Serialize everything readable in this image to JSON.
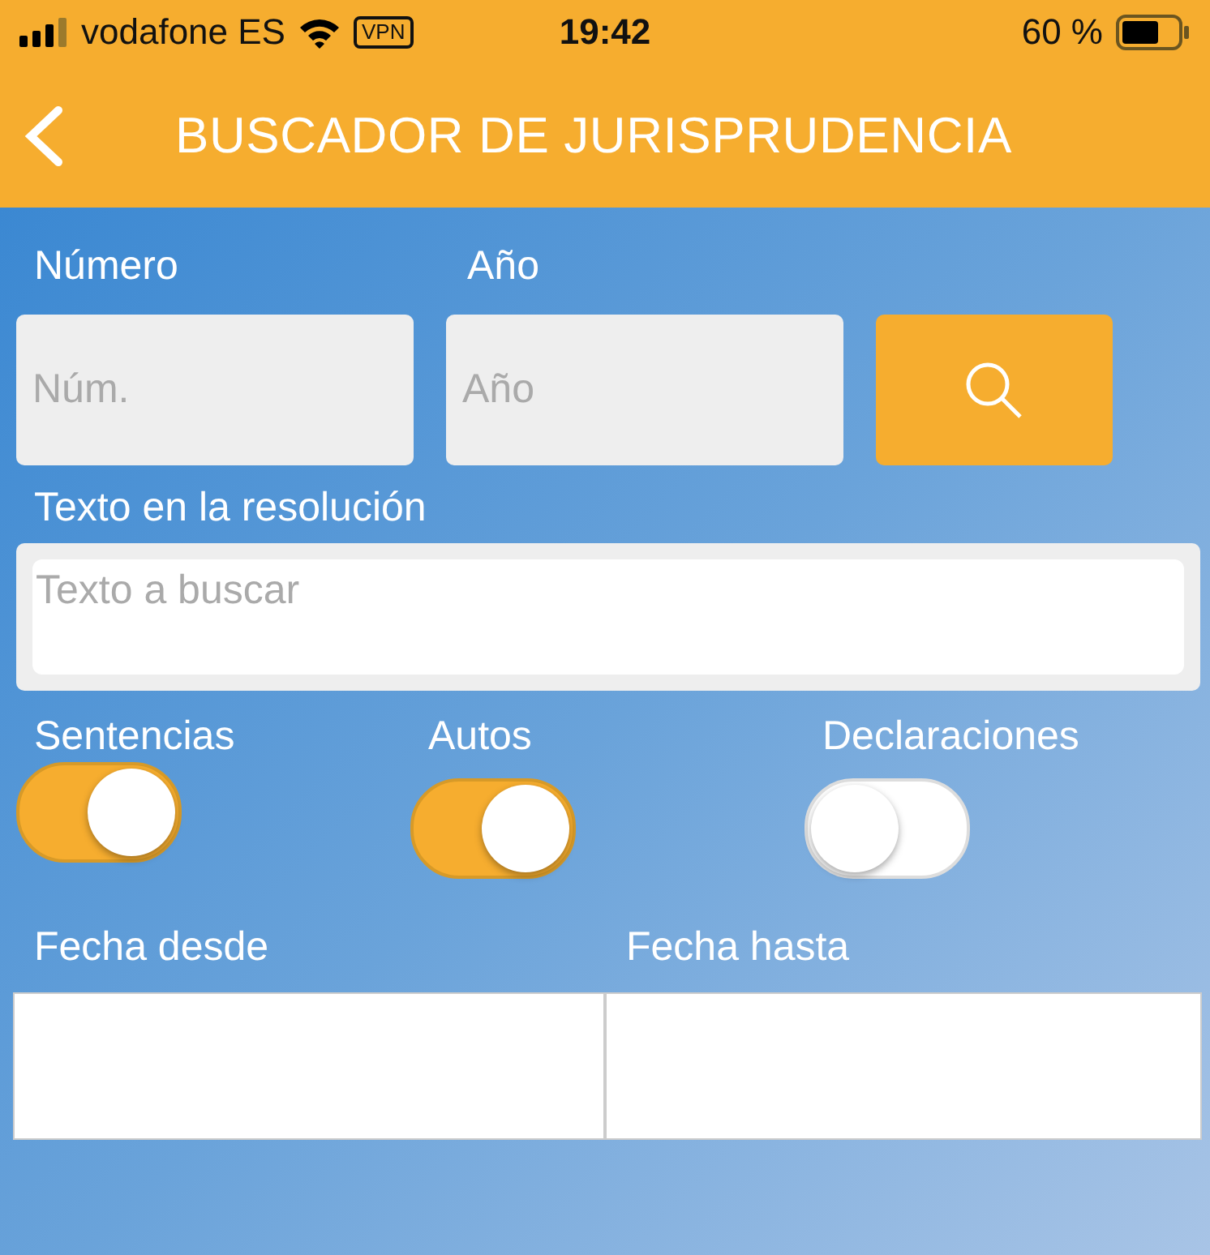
{
  "status_bar": {
    "carrier": "vodafone ES",
    "vpn": "VPN",
    "time": "19:42",
    "battery": "60 %"
  },
  "header": {
    "title": "BUSCADOR DE JURISPRUDENCIA"
  },
  "numero": {
    "label": "Número",
    "placeholder": "Núm."
  },
  "anio": {
    "label": "Año",
    "placeholder": "Año"
  },
  "texto": {
    "label": "Texto en la resolución",
    "placeholder": "Texto a buscar"
  },
  "toggles": [
    {
      "label": "Sentencias",
      "on": true
    },
    {
      "label": "Autos",
      "on": true
    },
    {
      "label": "Declaraciones",
      "on": false
    }
  ],
  "fecha_desde": {
    "label": "Fecha desde"
  },
  "fecha_hasta": {
    "label": "Fecha hasta"
  }
}
